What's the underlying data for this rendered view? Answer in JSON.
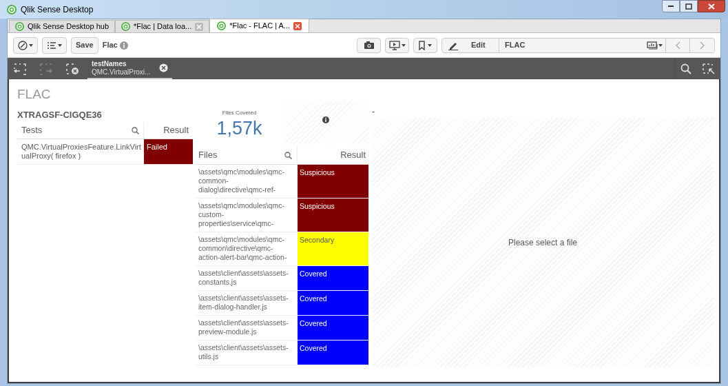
{
  "window": {
    "title": "Qlik Sense Desktop"
  },
  "browser_tabs": [
    {
      "label": "Qlik Sense Desktop hub",
      "selected": false,
      "closable": false
    },
    {
      "label": "*Flac | Data loa...",
      "selected": false,
      "closable": true
    },
    {
      "label": "*Flac - FLAC | A...",
      "selected": true,
      "closable": true
    }
  ],
  "toolbar": {
    "save": "Save",
    "app_name": "Flac",
    "edit": "Edit",
    "sheet_name": "FLAC"
  },
  "selections": [
    {
      "field": "testNames",
      "value": "QMC.VirtualProxi..."
    }
  ],
  "sheet": {
    "title": "FLAC",
    "host": "XTRAGSF-CIGQE36",
    "tests_table": {
      "columns": [
        "Tests",
        "Result"
      ],
      "rows": [
        {
          "name": "QMC.VirtualProxiesFeature.LinkVirtualProxy( firefox )",
          "result": "Failed",
          "color": "#800000"
        }
      ]
    },
    "kpi": {
      "label": "Files Covered",
      "value": "1,57k"
    },
    "files_table": {
      "columns": [
        "Files",
        "Result"
      ],
      "rows": [
        {
          "file": "\\assets\\qmc\\modules\\qmc-common-dialog\\directive\\qmc-ref-",
          "result": "Suspicious",
          "color": "#800000"
        },
        {
          "file": "\\assets\\qmc\\modules\\qmc-custom-properties\\service\\qmc-",
          "result": "Suspicious",
          "color": "#800000"
        },
        {
          "file": "\\assets\\qmc\\modules\\qmc-common\\directive\\qmc-action-alert-bar\\qmc-action-",
          "result": "Secondary",
          "color": "#ffff00"
        },
        {
          "file": "\\assets\\client\\assets\\assets-constants.js",
          "result": "Covered",
          "color": "#0000ff"
        },
        {
          "file": "\\assets\\client\\assets\\assets-item-dialog-handler.js",
          "result": "Covered",
          "color": "#0000ff"
        },
        {
          "file": "\\assets\\client\\assets\\assets-preview-module.js",
          "result": "Covered",
          "color": "#0000ff"
        },
        {
          "file": "\\assets\\client\\assets\\assets-utils.js",
          "result": "Covered",
          "color": "#0000ff"
        }
      ]
    },
    "dash": "-",
    "detail_placeholder": "Please select a file"
  }
}
